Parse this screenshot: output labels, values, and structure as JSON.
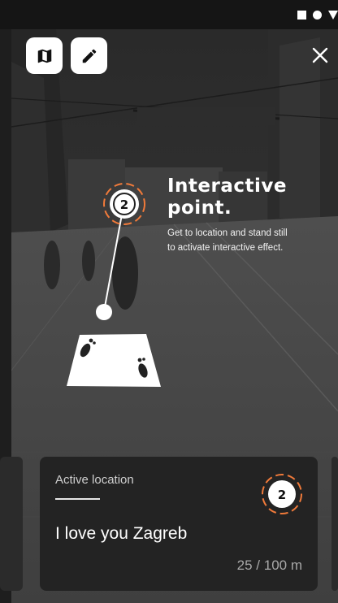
{
  "status_bar": {
    "icons": [
      "square-icon",
      "circle-icon",
      "triangle-icon"
    ]
  },
  "toolbar": {
    "map_icon": "map-icon",
    "edit_icon": "pencil-icon",
    "close_icon": "close-icon"
  },
  "overlay": {
    "title_line1": "Interactive",
    "title_line2": "point.",
    "description": "Get to location and stand still to activate interactive effect.",
    "marker_number": "2",
    "accent_color": "#f07a3a"
  },
  "active_card": {
    "label": "Active location",
    "name": "I love you Zagreb",
    "distance": "25 / 100 m",
    "marker_number": "2"
  }
}
